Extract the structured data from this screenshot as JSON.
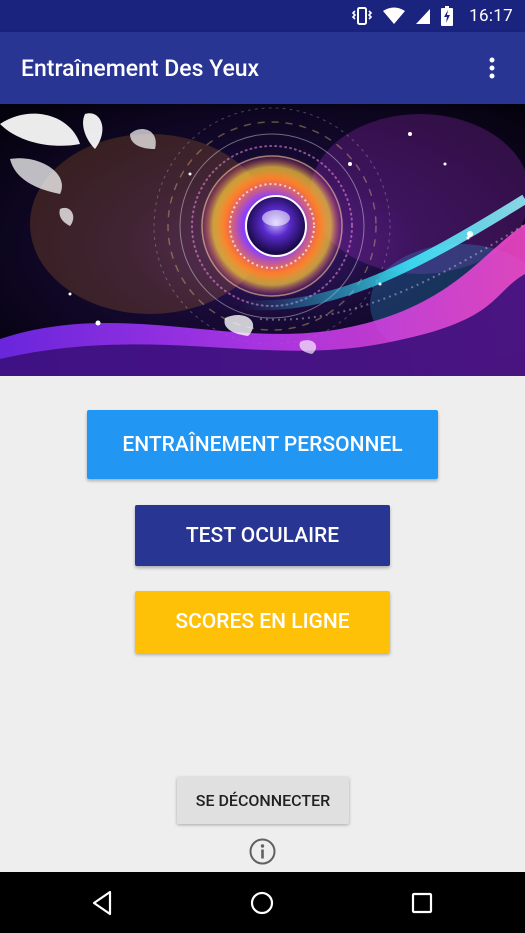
{
  "status_bar": {
    "time": "16:17",
    "icons": [
      "vibrate-icon",
      "wifi-icon",
      "signal-icon",
      "battery-charging-icon"
    ]
  },
  "app_bar": {
    "title": "Entraînement Des Yeux",
    "overflow_icon": "more-vert-icon"
  },
  "hero": {
    "image": "colorful-eye-illustration"
  },
  "buttons": {
    "personal_training": "ENTRAÎNEMENT PERSONNEL",
    "eye_test": "TEST OCULAIRE",
    "online_scores": "SCORES EN LIGNE",
    "logout": "SE DÉCONNECTER"
  },
  "info_icon": "info-icon",
  "nav_bar": {
    "icons": [
      "back-icon",
      "home-icon",
      "recents-icon"
    ]
  },
  "colors": {
    "status_bar": "#1a237e",
    "app_bar": "#283593",
    "personal_button": "#2196f3",
    "test_button": "#283593",
    "scores_button": "#ffc107",
    "logout_button": "#e0e0e0",
    "background": "#eeeeee"
  }
}
